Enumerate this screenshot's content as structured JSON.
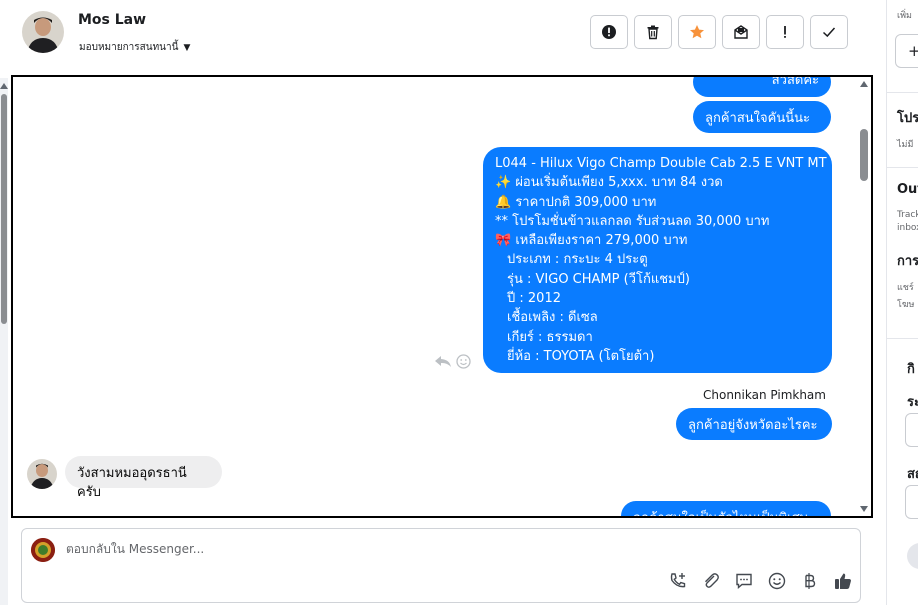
{
  "header": {
    "contact_name": "Mos Law",
    "assign_label": "มอบหมายการสนทนานี้",
    "actions": [
      {
        "name": "spam-button",
        "icon": "alert-circle-icon"
      },
      {
        "name": "delete-button",
        "icon": "trash-icon"
      },
      {
        "name": "star-button",
        "icon": "star-icon"
      },
      {
        "name": "mark-unread-button",
        "icon": "envelope-icon"
      },
      {
        "name": "follow-up-button",
        "icon": "exclamation-icon"
      },
      {
        "name": "mark-done-button",
        "icon": "check-icon"
      }
    ],
    "star_color": "#f7923b"
  },
  "conversation": {
    "messages": {
      "m1": "สวัสดีคะ",
      "m2": "ลูกค้าสนใจคันนี้นะคะ",
      "m3": {
        "lines": [
          "L044 - Hilux Vigo Champ Double Cab 2.5 E VNT MT",
          "✨  ผ่อนเริ่มต้นเพียง 5,xxx. บาท 84 งวด",
          "🔔   ราคาปกติ 309,000 บาท",
          "** โปรโมชั่นข้าวแลกลด รับส่วนลด 30,000 บาท",
          "🎀  เหลือเพียงราคา 279,000 บาท",
          "ประเภท : กระบะ 4 ประตู",
          "รุ่น : VIGO CHAMP (วีโก้แชมป์)",
          "ปี : 2012",
          "เชื้อเพลิง : ดีเซล",
          "เกียร์ : ธรรมดา",
          "ยี่ห้อ : TOYOTA (โตโยต้า)"
        ]
      },
      "sender_name": "Chonnikan Pimkham",
      "m4": "ลูกค้าอยู่จังหวัดอะไรคะ",
      "m5": "วังสามหมออุดรธานีครับ",
      "m6": "ลูกค้าสนใจเป็นตัวไหนเป็นพิเศษ"
    },
    "outgoing_color": "#0a7cff",
    "incoming_color": "#eeeeef"
  },
  "reply": {
    "placeholder": "ตอบกลับใน Messenger...",
    "icons": [
      "call-add-icon",
      "attachment-icon",
      "saved-replies-icon",
      "emoji-icon",
      "baht-icon",
      "thumbs-up-icon"
    ]
  },
  "right_panel": {
    "t1": "เพิ่ม",
    "t2": "โปร",
    "t3": "ไม่มี",
    "t4": "Out",
    "t5": "Track",
    "t6": "inbox",
    "t7": "การ",
    "t8": "แชร์",
    "t9": "โฆษ",
    "t10": "กิ",
    "t11": "ระ",
    "t12": "สถ"
  }
}
